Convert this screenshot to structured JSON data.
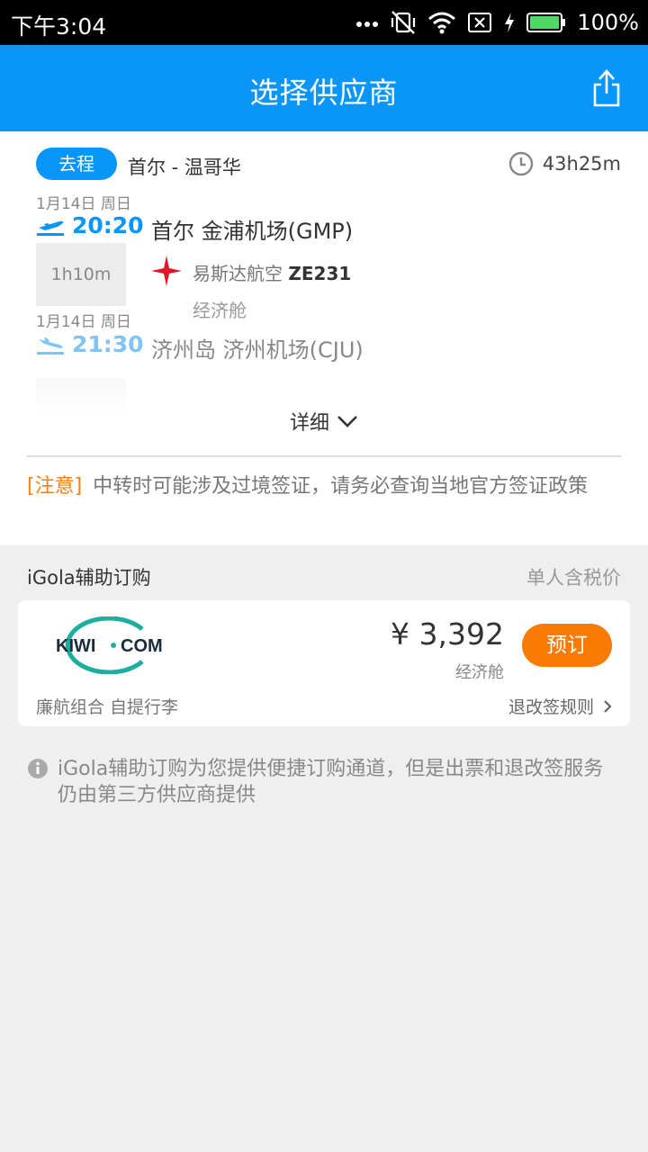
{
  "status_bar": {
    "time": "下午3:04",
    "battery": "100%",
    "icons": [
      "dots-icon",
      "vibrate-off-icon",
      "wifi-icon",
      "sim-x-icon",
      "charging-icon",
      "battery-icon"
    ]
  },
  "app_bar": {
    "title": "选择供应商",
    "share_icon": "share-icon"
  },
  "flight": {
    "direction_badge": "去程",
    "route": "首尔 - 温哥华",
    "total_duration": "43h25m",
    "segment": {
      "dep_date": "1月14日 周日",
      "dep_time": "20:20",
      "dep_airport": "首尔 金浦机场(GMP)",
      "flight_duration": "1h10m",
      "airline": "易斯达航空",
      "flight_no": "ZE231",
      "cabin": "经济舱",
      "arr_date": "1月14日 周日",
      "arr_time": "21:30",
      "arr_airport": "济州岛 济州机场(CJU)"
    },
    "detail_toggle": "详细",
    "notice_tag": "[注意]",
    "notice_text": "中转时可能涉及过境签证，请务必查询当地官方签证政策"
  },
  "supplier_section": {
    "title": "iGola辅助订购",
    "price_note": "单人含税价",
    "suppliers": [
      {
        "name": "KIWI·COM",
        "logo_left": "KIWI",
        "logo_right": "COM",
        "price": "¥ 3,392",
        "cabin": "经济舱",
        "book_label": "预订",
        "tags": "廉航组合 自提行李",
        "refund_rule": "退改签规则"
      }
    ],
    "info_text": "iGola辅助订购为您提供便捷订购通道，但是出票和退改签服务仍由第三方供应商提供"
  },
  "colors": {
    "primary": "#0a96f8",
    "accent": "#f97a04",
    "notice": "#f57f17"
  }
}
